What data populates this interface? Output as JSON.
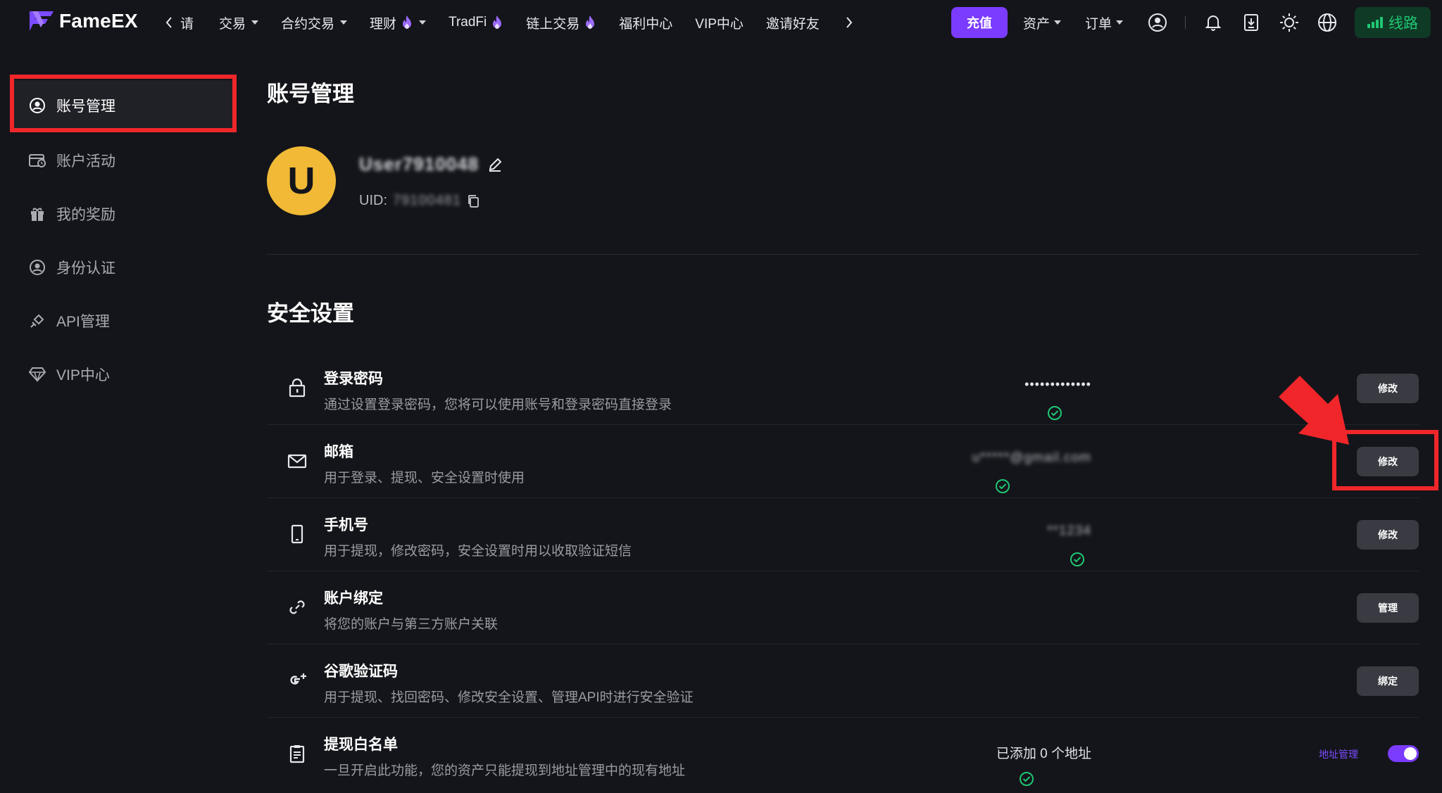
{
  "brand": {
    "name": "FameEX"
  },
  "nav": {
    "partial_item": "请",
    "items": [
      {
        "label": "交易",
        "dropdown": true,
        "hot": false
      },
      {
        "label": "合约交易",
        "dropdown": true,
        "hot": false
      },
      {
        "label": "理财",
        "dropdown": true,
        "hot": true
      },
      {
        "label": "TradFi",
        "dropdown": false,
        "hot": true
      },
      {
        "label": "链上交易",
        "dropdown": false,
        "hot": true
      },
      {
        "label": "福利中心",
        "dropdown": false,
        "hot": false
      },
      {
        "label": "VIP中心",
        "dropdown": false,
        "hot": false
      },
      {
        "label": "邀请好友",
        "dropdown": false,
        "hot": false
      }
    ]
  },
  "topbar_right": {
    "recharge_label": "充值",
    "assets_label": "资产",
    "orders_label": "订单",
    "line_label": "线路",
    "icons": [
      "user-circle-icon",
      "bell-icon",
      "download-icon",
      "sun-icon",
      "globe-icon"
    ]
  },
  "sidebar": {
    "items": [
      {
        "label": "账号管理",
        "icon": "user-circle-icon",
        "active": true
      },
      {
        "label": "账户活动",
        "icon": "account-activity-icon",
        "active": false
      },
      {
        "label": "我的奖励",
        "icon": "gift-icon",
        "active": false
      },
      {
        "label": "身份认证",
        "icon": "id-verify-icon",
        "active": false
      },
      {
        "label": "API管理",
        "icon": "api-icon",
        "active": false
      },
      {
        "label": "VIP中心",
        "icon": "diamond-icon",
        "active": false
      }
    ]
  },
  "profile": {
    "page_title": "账号管理",
    "avatar_letter": "U",
    "username": "User7910048",
    "uid_label": "UID:",
    "uid_value": "79100481"
  },
  "security": {
    "title": "安全设置",
    "rows": [
      {
        "key": "password",
        "icon": "lock-icon",
        "title": "登录密码",
        "desc": "通过设置登录密码，您将可以使用账号和登录密码直接登录",
        "status": "•••••••••••••",
        "status_verified": true,
        "status_blurred": false,
        "action": "修改"
      },
      {
        "key": "email",
        "icon": "mail-icon",
        "title": "邮箱",
        "desc": "用于登录、提现、安全设置时使用",
        "status": "u*****@gmail.com",
        "status_verified": true,
        "status_blurred": true,
        "action": "修改"
      },
      {
        "key": "phone",
        "icon": "phone-icon",
        "title": "手机号",
        "desc": "用于提现，修改密码，安全设置时用以收取验证短信",
        "status": "**1234",
        "status_verified": true,
        "status_blurred": true,
        "action": "修改"
      },
      {
        "key": "binding",
        "icon": "link-icon",
        "title": "账户绑定",
        "desc": "将您的账户与第三方账户关联",
        "status": "",
        "status_verified": false,
        "status_blurred": false,
        "action": "管理"
      },
      {
        "key": "google",
        "icon": "google-auth-icon",
        "title": "谷歌验证码",
        "desc": "用于提现、找回密码、修改安全设置、管理API时进行安全验证",
        "status": "",
        "status_verified": false,
        "status_blurred": false,
        "action": "绑定"
      },
      {
        "key": "whitelist",
        "icon": "clipboard-icon",
        "title": "提现白名单",
        "desc": "一旦开启此功能，您的资产只能提现到地址管理中的现有地址",
        "status": "已添加 0 个地址",
        "status_verified": true,
        "status_blurred": false,
        "link": "地址管理",
        "toggle_on": true
      }
    ]
  },
  "colors": {
    "accent": "#7b3cff",
    "success": "#1fc773",
    "annotation": "#f0262a",
    "avatar": "#f1b935"
  }
}
